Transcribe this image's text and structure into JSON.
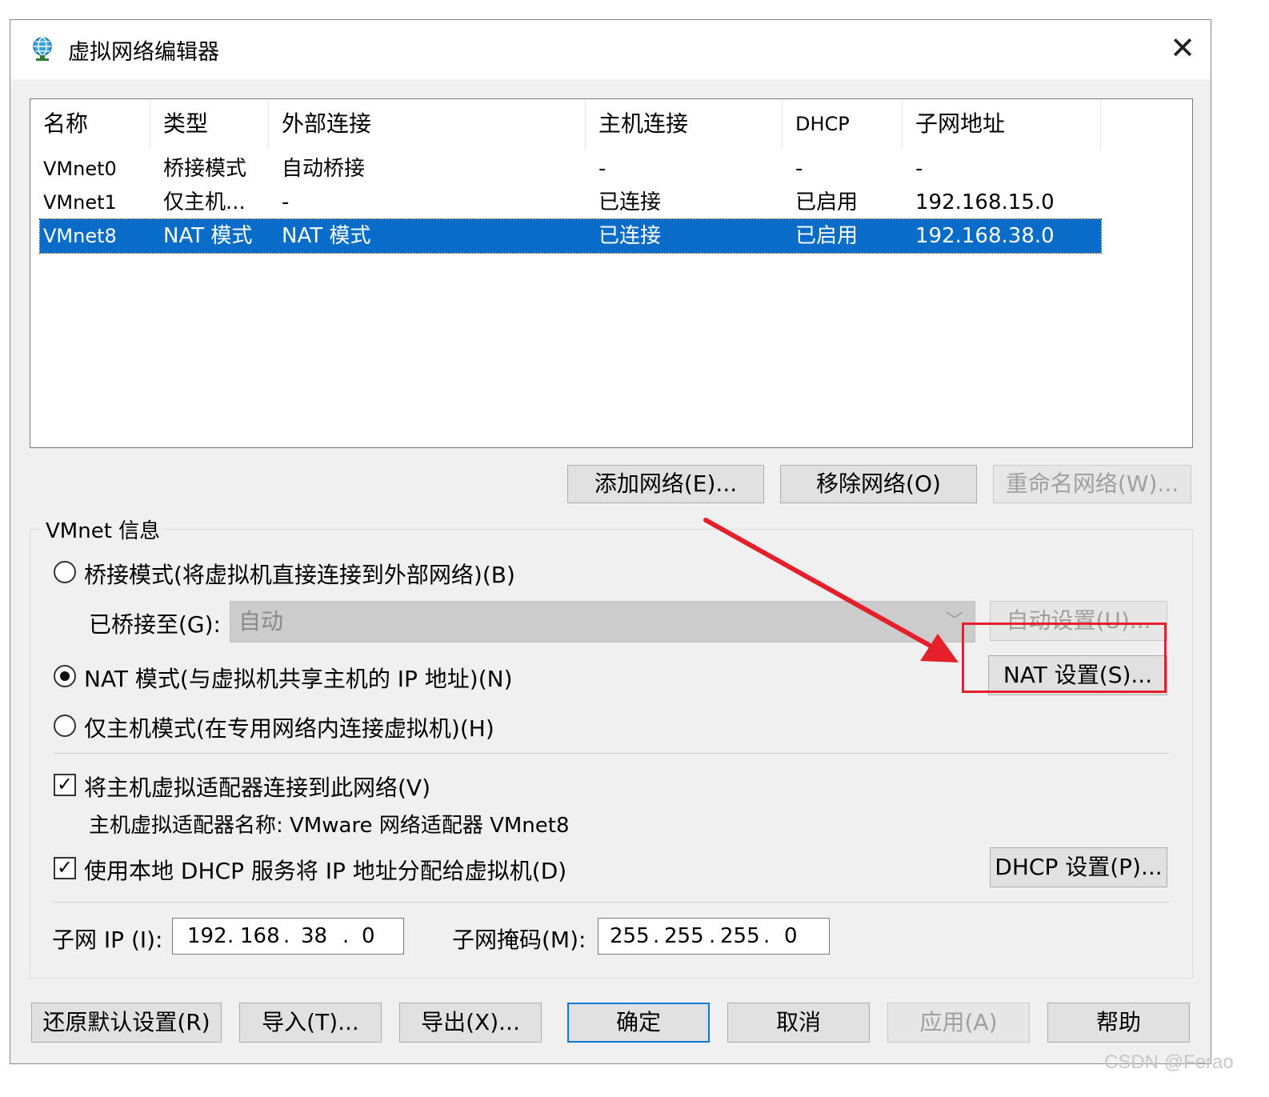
{
  "window": {
    "title": "虚拟网络编辑器",
    "close_glyph": "✕"
  },
  "table": {
    "headers": [
      "名称",
      "类型",
      "外部连接",
      "主机连接",
      "DHCP",
      "子网地址"
    ],
    "rows": [
      [
        "VMnet0",
        "桥接模式",
        "自动桥接",
        "-",
        "-",
        "-"
      ],
      [
        "VMnet1",
        "仅主机...",
        "-",
        "已连接",
        "已启用",
        "192.168.15.0"
      ],
      [
        "VMnet8",
        "NAT 模式",
        "NAT 模式",
        "已连接",
        "已启用",
        "192.168.38.0"
      ]
    ],
    "selected_row": 2
  },
  "network_buttons": {
    "add": "添加网络(E)...",
    "remove": "移除网络(O)",
    "rename": "重命名网络(W)..."
  },
  "vmnet_info": {
    "group_label": "VMnet 信息",
    "bridged_radio": "桥接模式(将虚拟机直接连接到外部网络)(B)",
    "bridged_to_label": "已桥接至(G):",
    "bridged_to_value": "自动",
    "auto_settings_button": "自动设置(U)...",
    "nat_radio": "NAT 模式(与虚拟机共享主机的 IP 地址)(N)",
    "nat_settings_button": "NAT 设置(S)...",
    "hostonly_radio": "仅主机模式(在专用网络内连接虚拟机)(H)",
    "selected_mode": "nat",
    "connect_adapter_check": "将主机虚拟适配器连接到此网络(V)",
    "connect_adapter_checked": true,
    "adapter_name_label": "主机虚拟适配器名称: VMware 网络适配器 VMnet8",
    "dhcp_check": "使用本地 DHCP 服务将 IP 地址分配给虚拟机(D)",
    "dhcp_checked": true,
    "dhcp_settings_button": "DHCP 设置(P)...",
    "subnet_ip_label": "子网 IP (I):",
    "subnet_ip": [
      "192",
      "168",
      "38",
      "0"
    ],
    "subnet_mask_label": "子网掩码(M):",
    "subnet_mask": [
      "255",
      "255",
      "255",
      "0"
    ]
  },
  "bottom_buttons": {
    "restore": "还原默认设置(R)",
    "import": "导入(T)...",
    "export": "导出(X)...",
    "ok": "确定",
    "cancel": "取消",
    "apply": "应用(A)",
    "help": "帮助"
  },
  "annotation": {
    "arrow_color": "#e5202a",
    "highlight_color": "#e5202a"
  },
  "watermark": "CSDN @Ferao",
  "colors": {
    "selection": "#0a6cc9",
    "dialog_bg": "#f0f0f0"
  }
}
